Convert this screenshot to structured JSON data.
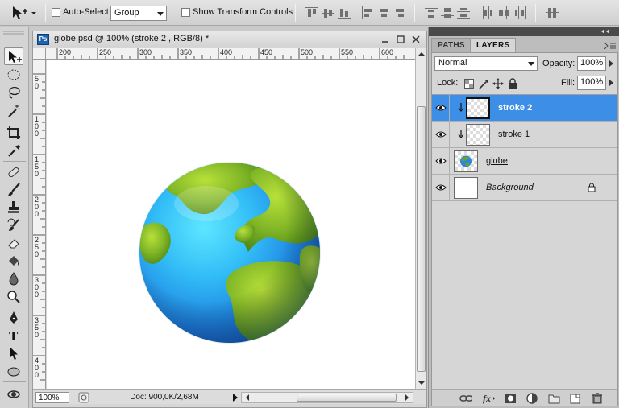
{
  "options_bar": {
    "tool_preset_icon": "move-tool-icon",
    "auto_select_label": "Auto-Select:",
    "auto_select_checked": false,
    "auto_select_value": "Group",
    "show_transform_label": "Show Transform Controls",
    "show_transform_checked": false
  },
  "document": {
    "title": "globe.psd @ 100% (stroke 2 , RGB/8) *",
    "app_badge": "Ps",
    "ruler_h_ticks": [
      "200",
      "250",
      "300",
      "350",
      "400",
      "450",
      "500",
      "550",
      "600"
    ],
    "ruler_v_ticks": [
      "50",
      "100",
      "150",
      "200",
      "250",
      "300",
      "350",
      "400"
    ],
    "zoom": "100%",
    "doc_info": "Doc: 900,0K/2,68M"
  },
  "panel": {
    "tabs": [
      "PATHS",
      "LAYERS"
    ],
    "active_tab": "LAYERS",
    "blend_mode": "Normal",
    "opacity_label": "Opacity:",
    "opacity_value": "100%",
    "lock_label": "Lock:",
    "fill_label": "Fill:",
    "fill_value": "100%",
    "layers": [
      {
        "name": "stroke 2",
        "selected": true,
        "clipped": true,
        "thumb": "transparent"
      },
      {
        "name": "stroke 1",
        "selected": false,
        "clipped": true,
        "thumb": "transparent"
      },
      {
        "name": "globe",
        "selected": false,
        "clipped": false,
        "thumb": "globe"
      },
      {
        "name": "Background",
        "selected": false,
        "clipped": false,
        "thumb": "white",
        "locked": true
      }
    ]
  },
  "colors": {
    "selection_blue": "#3d8ee6",
    "ocean_blue": "#2a86e0",
    "land_green": "#6aa51f"
  }
}
